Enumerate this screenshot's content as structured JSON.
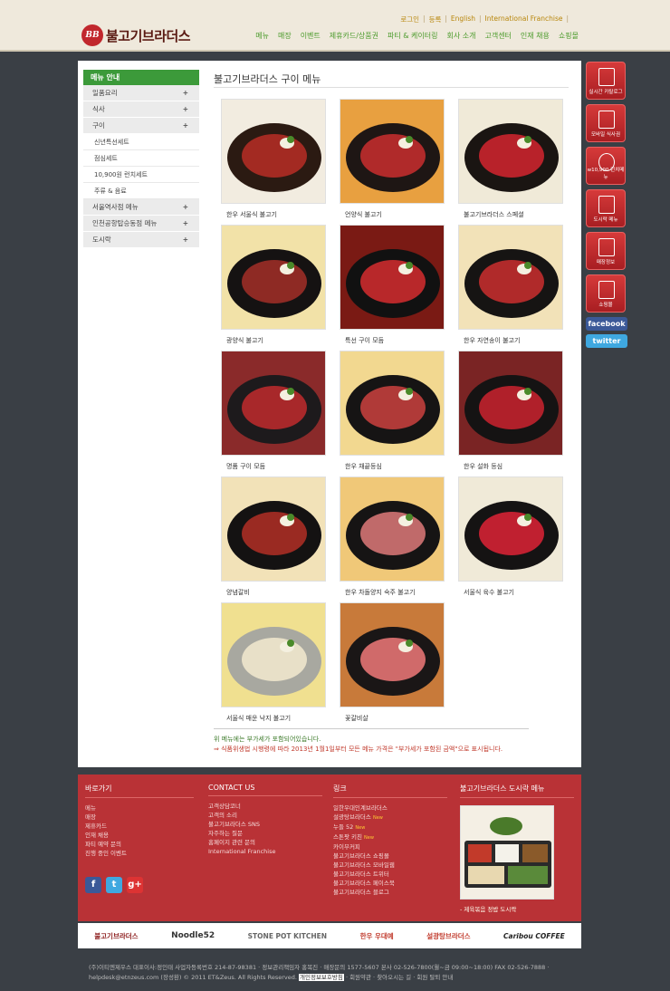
{
  "brand": {
    "badge": "BB",
    "name": "불고기브라더스"
  },
  "util_nav": [
    "로그인",
    "등록",
    "English",
    "International Franchise"
  ],
  "main_nav": [
    "메뉴",
    "매장",
    "이벤트",
    "제휴카드/상품권",
    "파티 & 케이터링",
    "회사 소개",
    "고객센터",
    "인재 채용",
    "쇼핑몰"
  ],
  "sidebar": {
    "title": "메뉴 안내",
    "items": [
      {
        "label": "일품요리",
        "expand": "+"
      },
      {
        "label": "식사",
        "expand": "+"
      },
      {
        "label": "구이",
        "expand": "+"
      }
    ],
    "subitems": [
      "신년특선세트",
      "점심세트",
      "10,900원 런치세트",
      "주류 & 음료"
    ],
    "items2": [
      {
        "label": "서울역사점 메뉴",
        "expand": "+"
      },
      {
        "label": "인천공항탑승동점 메뉴",
        "expand": "+"
      },
      {
        "label": "도시락",
        "expand": "+"
      }
    ]
  },
  "page_title": "불고기브라더스 구이 메뉴",
  "menu_items": [
    "한우 서울식 불고기",
    "언양식 불고기",
    "불고기브라더스 스페셜",
    "광양식 불고기",
    "특선 구이 모듬",
    "한우 자연송이 불고기",
    "명품 구이 모듬",
    "한우 채끝등심",
    "한우 설화 등심",
    "양념갈비",
    "한우 차돌양지 숙주 불고기",
    "서울식 육수 불고기",
    "서울식 매운 낙지 불고기",
    "꽃갈비살"
  ],
  "notes": {
    "line1": "위 메뉴에는 부가세가 포함되어있습니다.",
    "line2": "⇒ 식품위생법 시행령에 따라 2013년 1월1일부터 모든 메뉴 가격은 \"부가세가 포함된 금액\"으로 표시됩니다."
  },
  "quick_menu": [
    "실시간 카탈로그",
    "모바일 식사권",
    "w10,900 런치메뉴",
    "도시락 메뉴",
    "매장정보",
    "쇼핑몰"
  ],
  "sns_buttons": {
    "facebook": "facebook",
    "twitter": "twitter"
  },
  "footer": {
    "col1": {
      "title": "바로가기",
      "links": [
        "메뉴",
        "매장",
        "제휴카드",
        "인재 채용",
        "파티 예약 문의",
        "진행 중인 이벤트"
      ]
    },
    "col2": {
      "title": "CONTACT US",
      "links": [
        "고객상담코너",
        "고객의 소리",
        "불고기브라더스 SNS",
        "자주하는 질문",
        "홈페이지 관련 문의",
        "International Franchise"
      ]
    },
    "col3": {
      "title": "링크",
      "links": [
        "일한우대인계브라더스",
        "설광탕브라더스",
        "누들 52",
        "스톤팟 키친",
        "카이부커피",
        "불고기브라더스 쇼핑몰",
        "불고기브라더스 모바일웹",
        "불고기브라더스 트위터",
        "불고기브라더스 페이스북",
        "불고기브라더스 블로그"
      ],
      "new_tag": "New"
    },
    "col4": {
      "title": "불고기브라더스 도시락 메뉴",
      "caption": "- 제육볶음 정밥 도시락"
    },
    "social": [
      "f",
      "t",
      "g+"
    ]
  },
  "partners": [
    "불고기브라더스",
    "Noodle52",
    "STONE POT KITCHEN",
    "한우 우대예",
    "설광탕브라더스",
    "Caribou COFFEE"
  ],
  "bottom_info": {
    "line1": "(주)이티엔제우스 대표이사:정인태 사업자등록번호 214-87-98381 · 정보관리책임자 홍복진 · 매장문의 1577-5607 본사 02-526-7800(월~금 09:00~18:00) FAX 02-526-7888 ·",
    "line2a": "helpdesk@etnzeus.com (장성환) © 2011 ET&Zeus. All Rights Reserved.",
    "line2b": "개인정보보호방침",
    "line2c": "· 회원약관 · 찾아오시는 길 · 회원 탈퇴 안내"
  },
  "colors": {
    "accent_green": "#3c9a3a",
    "brand_red": "#b93236",
    "background": "#3a3f45"
  }
}
